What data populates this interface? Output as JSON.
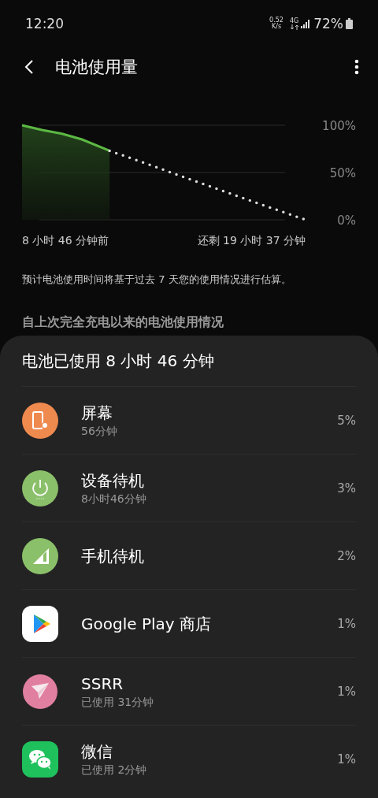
{
  "status_bar": {
    "time": "12:20",
    "net_speed": "0.52",
    "net_unit": "K/s",
    "network": "4G",
    "battery": "72%"
  },
  "header": {
    "title": "电池使用量"
  },
  "chart": {
    "y_labels": [
      "100%",
      "50%",
      "0%"
    ],
    "start_label": "8 小时 46 分钟前",
    "end_label": "还剩 19 小时 37 分钟"
  },
  "note": "预计电池使用时间将基于过去 7 天您的使用情况进行估算。",
  "section_title": "自上次完全充电以来的电池使用情况",
  "usage": {
    "title": "电池已使用 8 小时 46 分钟",
    "items": [
      {
        "kind": "screen",
        "name": "屏幕",
        "detail": "56分钟",
        "percent": "5%"
      },
      {
        "kind": "standby",
        "name": "设备待机",
        "detail": "8小时46分钟",
        "percent": "3%"
      },
      {
        "kind": "cell",
        "name": "手机待机",
        "percent": "2%"
      },
      {
        "kind": "play",
        "name": "Google Play 商店",
        "percent": "1%"
      },
      {
        "kind": "plane",
        "name": "SSRR",
        "detail": "已使用 31分钟",
        "percent": "1%"
      },
      {
        "kind": "chat",
        "name": "微信",
        "detail": "已使用 2分钟",
        "percent": "1%"
      }
    ]
  }
}
